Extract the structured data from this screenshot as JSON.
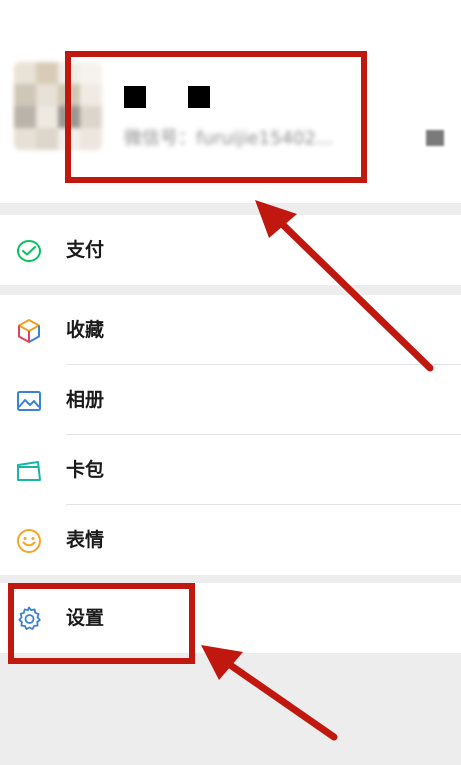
{
  "profile": {
    "nickname": "■ ■",
    "wechat_id": "微信号：furuijie15402..."
  },
  "menu": {
    "pay": {
      "label": "支付",
      "icon": "wechat-pay-icon"
    },
    "favorites": {
      "label": "收藏",
      "icon": "favorites-cube-icon"
    },
    "album": {
      "label": "相册",
      "icon": "album-image-icon"
    },
    "cards": {
      "label": "卡包",
      "icon": "card-wallet-icon"
    },
    "stickers": {
      "label": "表情",
      "icon": "smiley-face-icon"
    },
    "settings": {
      "label": "设置",
      "icon": "gear-icon"
    }
  },
  "colors": {
    "annotation_red": "#c0170f",
    "background": "#ededed",
    "pay_green": "#07c160",
    "settings_blue": "#3b82d6"
  }
}
